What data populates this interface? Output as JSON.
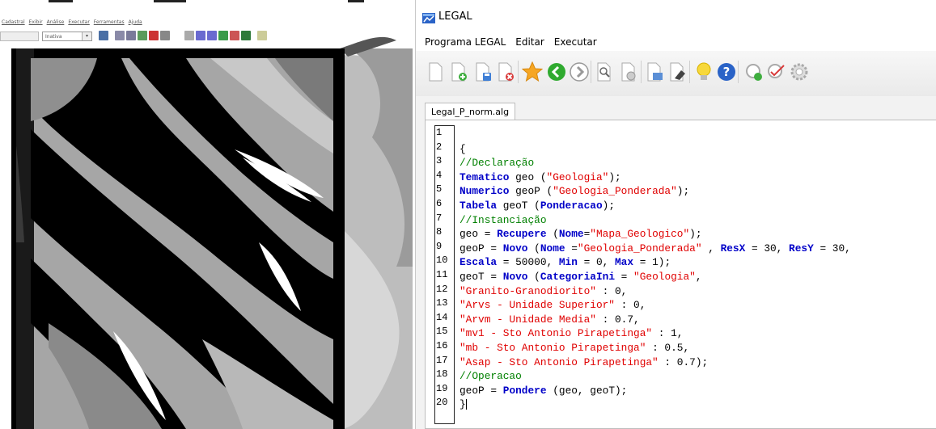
{
  "left_window": {
    "menu": [
      "Cadastral",
      "Exibir",
      "Análise",
      "Executar",
      "Ferramentas",
      "Ajuda"
    ],
    "combo_value": "Inativa"
  },
  "right_window": {
    "title": "LEGAL",
    "menu": [
      "Programa LEGAL",
      "Editar",
      "Executar"
    ],
    "tab_label": "Legal_P_norm.alg",
    "toolbar_icons": [
      "new-document-icon",
      "add-document-icon",
      "save-icon",
      "close-document-icon",
      "favorite-star-icon",
      "back-arrow-icon",
      "forward-arrow-icon",
      "find-icon",
      "find-replace-icon",
      "export-icon",
      "erase-icon",
      "tip-lightbulb-icon",
      "help-icon",
      "run-icon",
      "check-icon",
      "settings-gear-icon"
    ],
    "line_numbers": [
      "1",
      "2",
      "3",
      "4",
      "5",
      "6",
      "7",
      "8",
      "9",
      "10",
      "11",
      "12",
      "13",
      "14",
      "15",
      "16",
      "17",
      "18",
      "19",
      "20"
    ],
    "code_lines": [
      [],
      [
        {
          "t": "{",
          "c": "p"
        }
      ],
      [
        {
          "t": "//Declaração",
          "c": "cm"
        }
      ],
      [
        {
          "t": "Tematico",
          "c": "kw"
        },
        {
          "t": " geo (",
          "c": "p"
        },
        {
          "t": "\"Geologia\"",
          "c": "str"
        },
        {
          "t": ");",
          "c": "p"
        }
      ],
      [
        {
          "t": "Numerico",
          "c": "kw"
        },
        {
          "t": " geoP (",
          "c": "p"
        },
        {
          "t": "\"Geologia_Ponderada\"",
          "c": "str"
        },
        {
          "t": ");",
          "c": "p"
        }
      ],
      [
        {
          "t": "Tabela",
          "c": "kw"
        },
        {
          "t": " geoT (",
          "c": "p"
        },
        {
          "t": "Ponderacao",
          "c": "kw"
        },
        {
          "t": ");",
          "c": "p"
        }
      ],
      [
        {
          "t": "//Instanciação",
          "c": "cm"
        }
      ],
      [
        {
          "t": "geo = ",
          "c": "p"
        },
        {
          "t": "Recupere",
          "c": "kw"
        },
        {
          "t": " (",
          "c": "p"
        },
        {
          "t": "Nome",
          "c": "kw"
        },
        {
          "t": "=",
          "c": "p"
        },
        {
          "t": "\"Mapa_Geologico\"",
          "c": "str"
        },
        {
          "t": ");",
          "c": "p"
        }
      ],
      [
        {
          "t": "geoP = ",
          "c": "p"
        },
        {
          "t": "Novo",
          "c": "kw"
        },
        {
          "t": " (",
          "c": "p"
        },
        {
          "t": "Nome",
          "c": "kw"
        },
        {
          "t": " =",
          "c": "p"
        },
        {
          "t": "\"Geologia_Ponderada\"",
          "c": "str"
        },
        {
          "t": " , ",
          "c": "p"
        },
        {
          "t": "ResX",
          "c": "kw"
        },
        {
          "t": " = 30, ",
          "c": "p"
        },
        {
          "t": "ResY",
          "c": "kw"
        },
        {
          "t": " = 30,",
          "c": "p"
        }
      ],
      [
        {
          "t": "Escala",
          "c": "kw"
        },
        {
          "t": " = 50000, ",
          "c": "p"
        },
        {
          "t": "Min",
          "c": "kw"
        },
        {
          "t": " = 0, ",
          "c": "p"
        },
        {
          "t": "Max",
          "c": "kw"
        },
        {
          "t": " = 1);",
          "c": "p"
        }
      ],
      [
        {
          "t": "geoT = ",
          "c": "p"
        },
        {
          "t": "Novo",
          "c": "kw"
        },
        {
          "t": " (",
          "c": "p"
        },
        {
          "t": "CategoriaIni",
          "c": "kw"
        },
        {
          "t": " = ",
          "c": "p"
        },
        {
          "t": "\"Geologia\"",
          "c": "str"
        },
        {
          "t": ",",
          "c": "p"
        }
      ],
      [
        {
          "t": "\"Granito-Granodiorito\"",
          "c": "str"
        },
        {
          "t": " : 0,",
          "c": "p"
        }
      ],
      [
        {
          "t": "\"Arvs - Unidade Superior\"",
          "c": "str"
        },
        {
          "t": " : 0,",
          "c": "p"
        }
      ],
      [
        {
          "t": "\"Arvm - Unidade Media\"",
          "c": "str"
        },
        {
          "t": " : 0.7,",
          "c": "p"
        }
      ],
      [
        {
          "t": "\"mv1 - Sto Antonio Pirapetinga\"",
          "c": "str"
        },
        {
          "t": " : 1,",
          "c": "p"
        }
      ],
      [
        {
          "t": "\"mb - Sto Antonio Pirapetinga\"",
          "c": "str"
        },
        {
          "t": " : 0.5,",
          "c": "p"
        }
      ],
      [
        {
          "t": "\"Asap - Sto Antonio Pirapetinga\"",
          "c": "str"
        },
        {
          "t": " : 0.7);",
          "c": "p"
        }
      ],
      [
        {
          "t": "//Operacao",
          "c": "cm"
        }
      ],
      [
        {
          "t": "geoP = ",
          "c": "p"
        },
        {
          "t": "Pondere",
          "c": "kw"
        },
        {
          "t": " (geo, geoT);",
          "c": "p"
        }
      ],
      [
        {
          "t": "}",
          "c": "p"
        }
      ]
    ]
  },
  "colors": {
    "keyword": "#0000c8",
    "string": "#e00000",
    "comment": "#008000"
  }
}
